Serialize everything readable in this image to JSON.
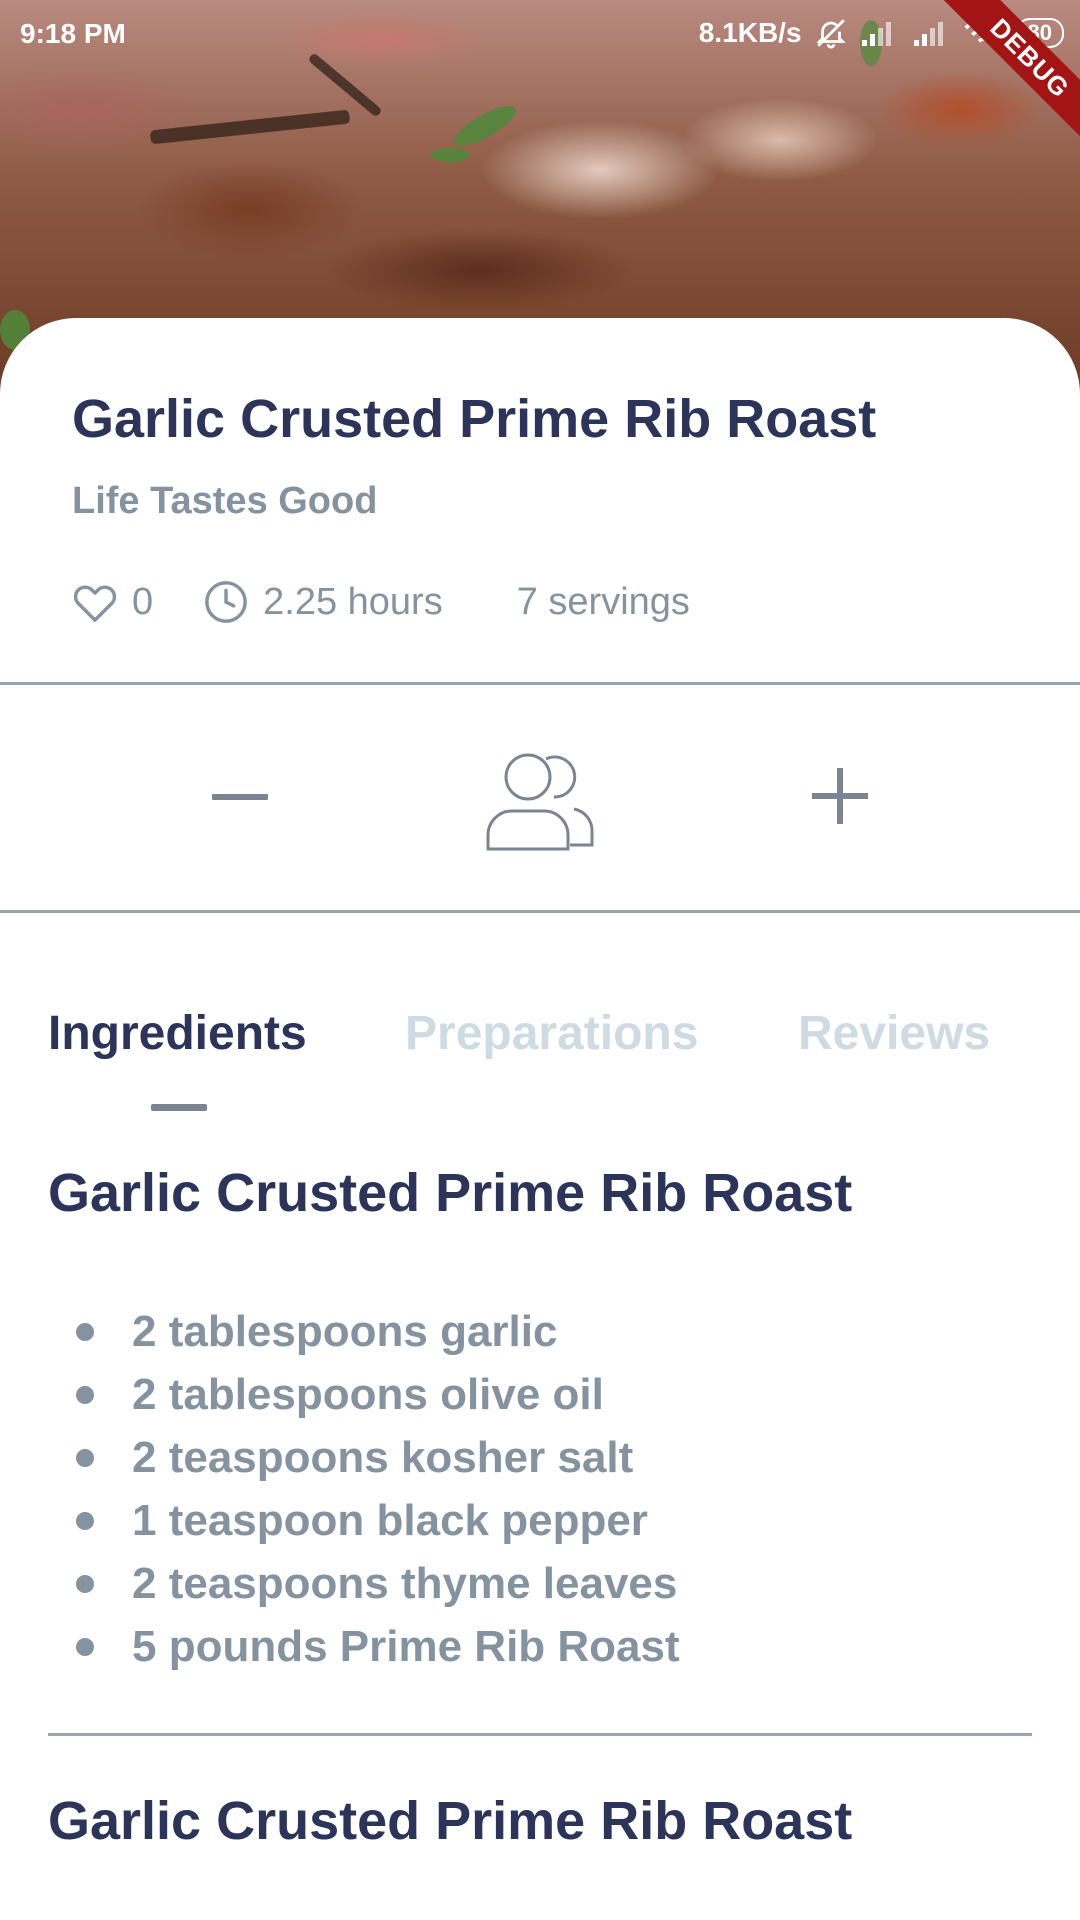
{
  "status_bar": {
    "time": "9:18 PM",
    "speed": "8.1KB/s",
    "battery": "80",
    "debug_label": "DEBUG"
  },
  "recipe": {
    "title": "Garlic Crusted Prime Rib Roast",
    "source": "Life Tastes Good",
    "likes": "0",
    "duration": "2.25 hours",
    "servings": "7 servings"
  },
  "tabs": [
    {
      "label": "Ingredients",
      "active": true
    },
    {
      "label": "Preparations",
      "active": false
    },
    {
      "label": "Reviews",
      "active": false
    }
  ],
  "ingredient_sections": [
    {
      "title": "Garlic Crusted Prime Rib Roast",
      "items": [
        "2 tablespoons garlic",
        "2 tablespoons olive oil",
        "2 teaspoons kosher salt",
        "1 teaspoon black pepper",
        "2 teaspoons thyme leaves",
        "5 pounds Prime Rib Roast"
      ]
    },
    {
      "title": "Garlic Crusted Prime Rib Roast"
    }
  ],
  "icons": {
    "decrease": "minus-icon",
    "servings": "people-icon",
    "increase": "plus-icon",
    "likes": "heart-outline-icon",
    "duration": "clock-icon"
  },
  "colors": {
    "title": "#2c3459",
    "muted": "#8593a0",
    "tab_inactive": "#cfdbe3",
    "divider": "#98a5ae",
    "debug": "#a31515"
  }
}
